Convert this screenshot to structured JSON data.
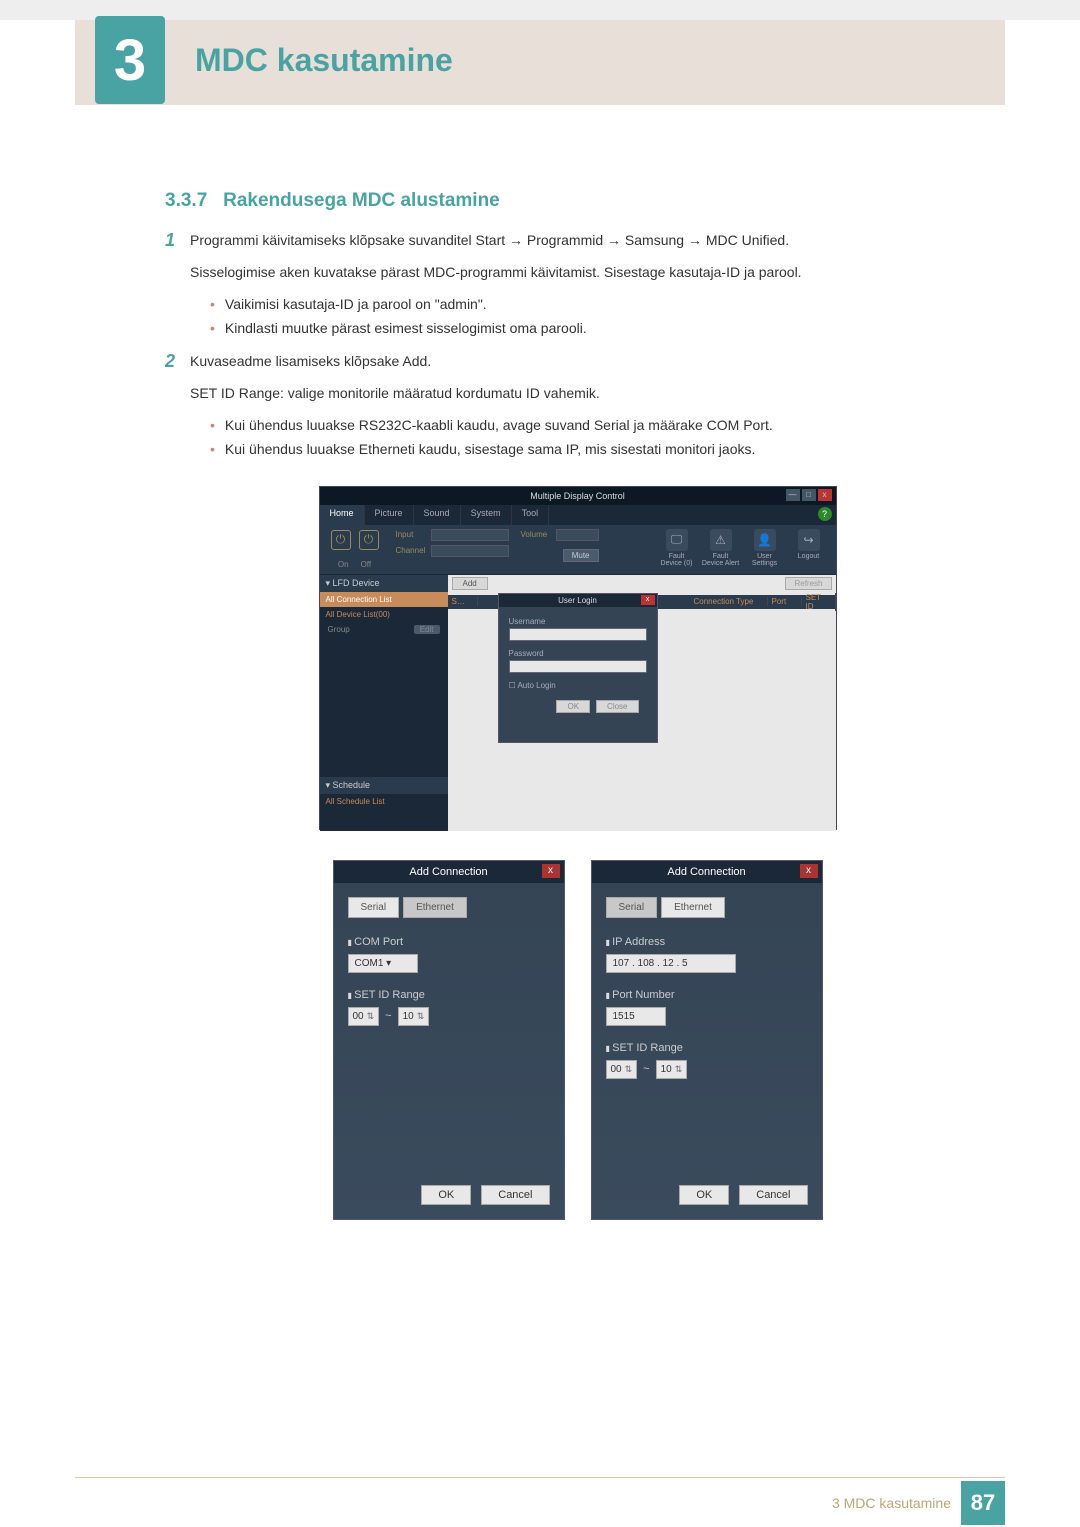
{
  "chapter": {
    "number": "3",
    "title": "MDC kasutamine"
  },
  "section": {
    "number": "3.3.7",
    "heading_text": "Rakendusega MDC alustamine"
  },
  "steps": {
    "s1": {
      "num": "1",
      "main": "Programmi käivitamiseks klõpsake suvanditel Start → Programmid → Samsung → MDC Unified.",
      "sub": "Sisselogimise aken kuvatakse pärast MDC-programmi käivitamist. Sisestage kasutaja-ID ja parool.",
      "b1": "Vaikimisi kasutaja-ID ja parool on \"admin\".",
      "b2": "Kindlasti muutke pärast esimest sisselogimist oma parooli."
    },
    "s2": {
      "num": "2",
      "main": "Kuvaseadme lisamiseks klõpsake Add.",
      "sub": "SET ID Range: valige monitorile määratud kordumatu ID vahemik.",
      "b1": "Kui ühendus luuakse RS232C-kaabli kaudu, avage suvand Serial ja määrake COM Port.",
      "b2": "Kui ühendus luuakse Etherneti kaudu, sisestage sama IP, mis sisestati monitori jaoks."
    }
  },
  "mdc_window": {
    "title": "Multiple Display Control",
    "tabs": {
      "home": "Home",
      "picture": "Picture",
      "sound": "Sound",
      "system": "System",
      "tool": "Tool"
    },
    "power": {
      "on": "On",
      "off": "Off"
    },
    "labels": {
      "input": "Input",
      "channel": "Channel",
      "volume": "Volume",
      "mute": "Mute"
    },
    "status": {
      "fault": "Fault Device (0)",
      "alert": "Fault Device Alert",
      "user": "User Settings",
      "logout": "Logout"
    },
    "sidebar": {
      "lfd": "LFD Device",
      "all_conn": "All Connection List",
      "all_dev": "All Device List(00)",
      "group": "Group",
      "edit": "Edit",
      "schedule": "Schedule",
      "all_sched": "All Schedule List"
    },
    "buttons": {
      "add": "Add",
      "refresh": "Refresh"
    },
    "table": {
      "sel": "S…",
      "conn": "Connection Type",
      "port": "Port",
      "setid": "SET ID"
    },
    "login": {
      "title": "User Login",
      "username": "Username",
      "password": "Password",
      "auto": "Auto Login",
      "ok": "OK",
      "close": "Close"
    }
  },
  "conn_serial": {
    "title": "Add Connection",
    "tab_serial": "Serial",
    "tab_ethernet": "Ethernet",
    "comport_label": "COM Port",
    "comport_value": "COM1",
    "range_label": "SET ID Range",
    "range_from": "00",
    "range_sep": "~",
    "range_to": "10",
    "ok": "OK",
    "cancel": "Cancel"
  },
  "conn_eth": {
    "title": "Add Connection",
    "tab_serial": "Serial",
    "tab_ethernet": "Ethernet",
    "ip_label": "IP Address",
    "ip_value": "107 . 108 . 12 . 5",
    "port_label": "Port Number",
    "port_value": "1515",
    "range_label": "SET ID Range",
    "range_from": "00",
    "range_sep": "~",
    "range_to": "10",
    "ok": "OK",
    "cancel": "Cancel"
  },
  "footer": {
    "text": "3 MDC kasutamine",
    "page": "87"
  }
}
